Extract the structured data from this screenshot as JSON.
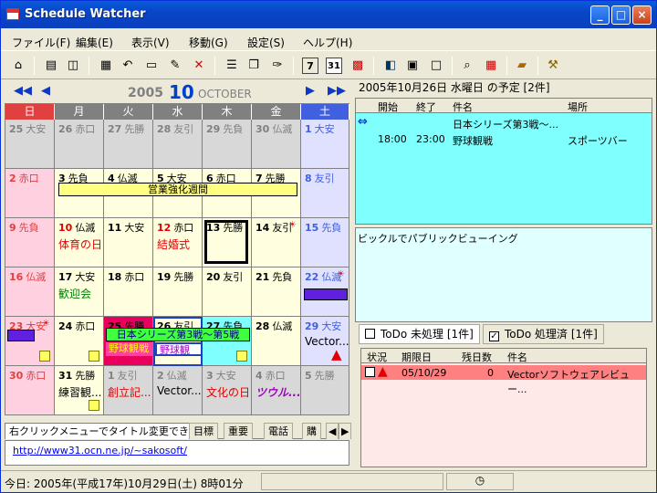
{
  "window": {
    "title": "Schedule Watcher"
  },
  "menu": [
    "ファイル(F)",
    "編集(E)",
    "表示(V)",
    "移動(G)",
    "設定(S)",
    "ヘルプ(H)"
  ],
  "toolbar": {
    "icons": [
      "home-icon",
      "print-icon",
      "print-preview-icon",
      "table-icon",
      "undo-icon",
      "note-icon",
      "edit-icon",
      "delete-icon",
      "list-icon",
      "copy-icon",
      "paint-icon",
      "week7-icon",
      "month31-icon",
      "grid-icon",
      "layout-icon",
      "panel-icon",
      "window-icon",
      "search-icon",
      "calendar-jump-icon",
      "book-icon",
      "tool-icon"
    ],
    "week_label": "7",
    "month_label": "31"
  },
  "calendar": {
    "year": "2005",
    "month": "10",
    "month_name": "OCTOBER",
    "weekdays": [
      "日",
      "月",
      "火",
      "水",
      "木",
      "金",
      "土"
    ],
    "weeks": [
      [
        {
          "d": "25",
          "r": "大安",
          "c": "gray"
        },
        {
          "d": "26",
          "r": "赤口",
          "c": "gray"
        },
        {
          "d": "27",
          "r": "先勝",
          "c": "gray"
        },
        {
          "d": "28",
          "r": "友引",
          "c": "gray"
        },
        {
          "d": "29",
          "r": "先負",
          "c": "gray"
        },
        {
          "d": "30",
          "r": "仏滅",
          "c": "gray"
        },
        {
          "d": "1",
          "r": "大安",
          "c": "sat"
        }
      ],
      [
        {
          "d": "2",
          "r": "赤口",
          "c": "sun"
        },
        {
          "d": "3",
          "r": "先負",
          "c": "w"
        },
        {
          "d": "4",
          "r": "仏滅",
          "c": "w"
        },
        {
          "d": "5",
          "r": "大安",
          "c": "w"
        },
        {
          "d": "6",
          "r": "赤口",
          "c": "w"
        },
        {
          "d": "7",
          "r": "先勝",
          "c": "w"
        },
        {
          "d": "8",
          "r": "友引",
          "c": "sat"
        }
      ],
      [
        {
          "d": "9",
          "r": "先負",
          "c": "sun"
        },
        {
          "d": "10",
          "r": "仏滅",
          "c": "w",
          "e": "体育の日",
          "hol": true
        },
        {
          "d": "11",
          "r": "大安",
          "c": "w"
        },
        {
          "d": "12",
          "r": "赤口",
          "c": "w",
          "e": "結婚式",
          "hol": true
        },
        {
          "d": "13",
          "r": "先勝",
          "c": "w",
          "today": true
        },
        {
          "d": "14",
          "r": "友引",
          "c": "w"
        },
        {
          "d": "15",
          "r": "先負",
          "c": "sat"
        }
      ],
      [
        {
          "d": "16",
          "r": "仏滅",
          "c": "sun"
        },
        {
          "d": "17",
          "r": "大安",
          "c": "w",
          "e": "歓迎会"
        },
        {
          "d": "18",
          "r": "赤口",
          "c": "w"
        },
        {
          "d": "19",
          "r": "先勝",
          "c": "w"
        },
        {
          "d": "20",
          "r": "友引",
          "c": "w"
        },
        {
          "d": "21",
          "r": "先負",
          "c": "w"
        },
        {
          "d": "22",
          "r": "仏滅",
          "c": "sat"
        }
      ],
      [
        {
          "d": "23",
          "r": "大安",
          "c": "sun"
        },
        {
          "d": "24",
          "r": "赤口",
          "c": "w"
        },
        {
          "d": "25",
          "r": "先勝",
          "c": "w"
        },
        {
          "d": "26",
          "r": "友引",
          "c": "w"
        },
        {
          "d": "27",
          "r": "先負",
          "c": "w"
        },
        {
          "d": "28",
          "r": "仏滅",
          "c": "w"
        },
        {
          "d": "29",
          "r": "大安",
          "c": "sat",
          "e": "Vector..."
        }
      ],
      [
        {
          "d": "30",
          "r": "赤口",
          "c": "sun"
        },
        {
          "d": "31",
          "r": "先勝",
          "c": "w",
          "e": "練習観..."
        },
        {
          "d": "1",
          "r": "友引",
          "c": "gray",
          "e": "創立記..."
        },
        {
          "d": "2",
          "r": "仏滅",
          "c": "gray",
          "e": "Vector..."
        },
        {
          "d": "3",
          "r": "大安",
          "c": "gray",
          "e": "文化の日"
        },
        {
          "d": "4",
          "r": "赤口",
          "c": "gray",
          "e": "ツウル..."
        },
        {
          "d": "5",
          "r": "先勝",
          "c": "gray"
        }
      ]
    ],
    "bars": {
      "eigyo": "営業強化週間",
      "series": "日本シリーズ第3戦～第5戦",
      "yakyu1": "野球観戦",
      "yakyu2": "野球観"
    }
  },
  "memo_tabs": [
    "右クリックメニューでタイトル変更できます",
    "目標",
    "重要",
    "電話",
    "購"
  ],
  "memo": {
    "link": "http://www31.ocn.ne.jp/~sakosoft/"
  },
  "schedule": {
    "header": "2005年10月26日 水曜日 の予定 [2件]",
    "cols": [
      "開始",
      "終了",
      "件名",
      "場所"
    ],
    "rows": [
      {
        "start": "",
        "end": "",
        "subject": "日本シリーズ第3戦～...",
        "place": ""
      },
      {
        "start": "18:00",
        "end": "23:00",
        "subject": "野球観戦",
        "place": "スポーツバー"
      }
    ],
    "note": "ビックルでパブリックビューイング"
  },
  "todo": {
    "tab_open": "ToDo 未処理 [1件]",
    "tab_done": "ToDo 処理済 [1件]",
    "cols": [
      "状況",
      "期限日",
      "残日数",
      "件名"
    ],
    "row": {
      "due": "05/10/29",
      "remain": "0",
      "subject": "Vectorソフトウェアレビュー..."
    }
  },
  "status": {
    "text": "今日: 2005年(平成17年)10月29日(土) 8時01分"
  },
  "colors": {
    "titlebar": "#0a5bd9",
    "schedule_bg": "#80ffff",
    "todo_row": "#ff8080"
  }
}
